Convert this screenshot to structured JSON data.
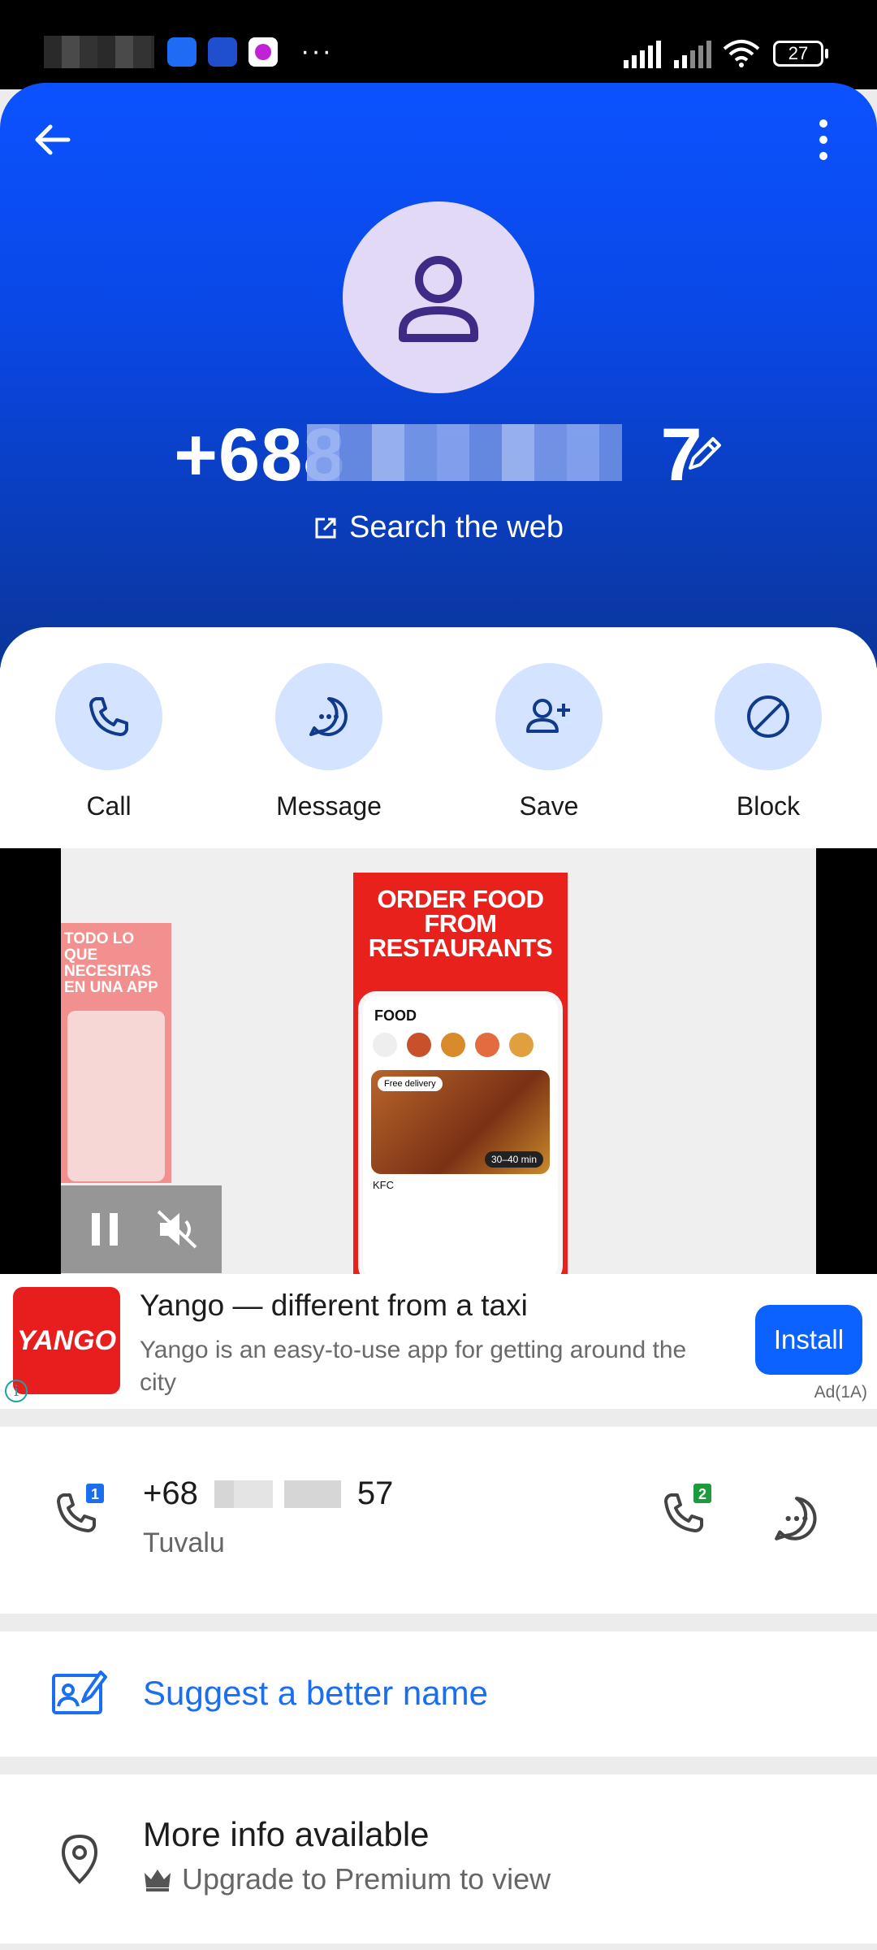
{
  "status_bar": {
    "battery": "27",
    "more": "···"
  },
  "header": {
    "phone_number": "+688",
    "phone_tail": "7",
    "search_web": "Search the web"
  },
  "actions": [
    {
      "label": "Call"
    },
    {
      "label": "Message"
    },
    {
      "label": "Save"
    },
    {
      "label": "Block"
    }
  ],
  "ad": {
    "promo_title": "ORDER FOOD FROM RESTAURANTS",
    "promo_left": "TODO LO QUE NECESITAS EN UNA APP",
    "promo_section": "FOOD",
    "promo_item": "KFC",
    "promo_badge": "Free delivery",
    "promo_time": "30–40 min",
    "brand": "YANGO",
    "title": "Yango — different from a taxi",
    "description": "Yango is an easy-to-use app for getting around the city",
    "install": "Install",
    "tag": "Ad(1A)",
    "info": "i"
  },
  "number_card": {
    "number_prefix": "+68",
    "number_suffix": "57",
    "country": "Tuvalu",
    "sim1": "1",
    "sim2": "2"
  },
  "suggest": {
    "label": "Suggest a better name"
  },
  "more_info": {
    "title": "More info available",
    "subtitle": "Upgrade to Premium to view"
  },
  "colors": {
    "header_blue": "#0b52ff",
    "accent_blue": "#1a6ef0",
    "action_circle": "#d4e3ff",
    "ad_red": "#e81e1e"
  }
}
